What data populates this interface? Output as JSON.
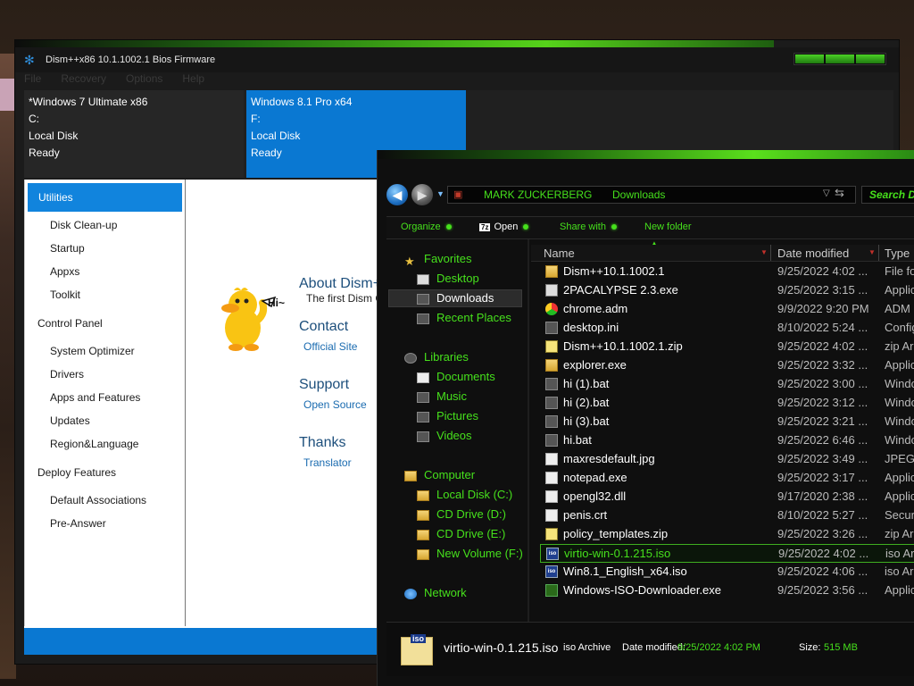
{
  "dism": {
    "title": "Dism++x86 10.1.1002.1 Bios Firmware",
    "menu": [
      "File",
      "Recovery",
      "Options",
      "Help"
    ],
    "sessions": [
      {
        "name": "*Windows 7 Ultimate x86",
        "drive": "C:",
        "disk": "Local Disk",
        "status": "Ready"
      },
      {
        "name": "Windows 8.1 Pro x64",
        "drive": "F:",
        "disk": "Local Disk",
        "status": "Ready"
      }
    ],
    "sidebar": {
      "selected": "Utilities",
      "utilities": [
        "Disk Clean-up",
        "Startup",
        "Appxs",
        "Toolkit"
      ],
      "control_panel": "Control Panel",
      "control_items": [
        "System Optimizer",
        "Drivers",
        "Apps and Features",
        "Updates",
        "Region&Language"
      ],
      "deploy": "Deploy Features",
      "deploy_items": [
        "Default Associations",
        "Pre-Answer"
      ]
    },
    "about": {
      "duck_text": "Hi~",
      "title": "About Dism++",
      "subtitle": "The first Dism GUI",
      "contact": "Contact",
      "contact_link": "Official Site",
      "support": "Support",
      "support_link": "Open Source",
      "thanks": "Thanks",
      "thanks_link": "Translator"
    }
  },
  "explorer": {
    "breadcrumb": [
      "MARK ZUCKERBERG",
      "Downloads"
    ],
    "search_placeholder": "Search D",
    "commands": {
      "organize": "Organize",
      "open": "Open",
      "share": "Share with",
      "new_folder": "New folder"
    },
    "nav": {
      "favorites": "Favorites",
      "desktop": "Desktop",
      "downloads": "Downloads",
      "recent": "Recent Places",
      "libraries": "Libraries",
      "documents": "Documents",
      "music": "Music",
      "pictures": "Pictures",
      "videos": "Videos",
      "computer": "Computer",
      "drive_c": "Local Disk (C:)",
      "drive_d": "CD Drive (D:)",
      "drive_e": "CD Drive (E:)",
      "drive_f": "New Volume (F:)",
      "network": "Network"
    },
    "columns": {
      "name": "Name",
      "date": "Date modified",
      "type": "Type"
    },
    "files": [
      {
        "name": "Dism++10.1.1002.1",
        "date": "9/25/2022 4:02 ...",
        "type": "File fo",
        "icon": "folder"
      },
      {
        "name": "2PACALYPSE 2.3.exe",
        "date": "9/25/2022 3:15 ...",
        "type": "Applic",
        "icon": "exe"
      },
      {
        "name": "chrome.adm",
        "date": "9/9/2022 9:20 PM",
        "type": "ADM F",
        "icon": "chrome"
      },
      {
        "name": "desktop.ini",
        "date": "8/10/2022 5:24 ...",
        "type": "Config",
        "icon": "dark"
      },
      {
        "name": "Dism++10.1.1002.1.zip",
        "date": "9/25/2022 4:02 ...",
        "type": "zip Ar",
        "icon": "zip"
      },
      {
        "name": "explorer.exe",
        "date": "9/25/2022 3:32 ...",
        "type": "Applic",
        "icon": "folder"
      },
      {
        "name": "hi (1).bat",
        "date": "9/25/2022 3:00 ...",
        "type": "Windo",
        "icon": "dark"
      },
      {
        "name": "hi (2).bat",
        "date": "9/25/2022 3:12 ...",
        "type": "Windo",
        "icon": "dark"
      },
      {
        "name": "hi (3).bat",
        "date": "9/25/2022 3:21 ...",
        "type": "Windo",
        "icon": "dark"
      },
      {
        "name": "hi.bat",
        "date": "9/25/2022 6:46 ...",
        "type": "Windo",
        "icon": "dark"
      },
      {
        "name": "maxresdefault.jpg",
        "date": "9/25/2022 3:49 ...",
        "type": "JPEG",
        "icon": "doc"
      },
      {
        "name": "notepad.exe",
        "date": "9/25/2022 3:17 ...",
        "type": "Applic",
        "icon": "doc"
      },
      {
        "name": "opengl32.dll",
        "date": "9/17/2020 2:38 ...",
        "type": "Applic",
        "icon": "doc"
      },
      {
        "name": "penis.crt",
        "date": "8/10/2022 5:27 ...",
        "type": "Secur",
        "icon": "doc"
      },
      {
        "name": "policy_templates.zip",
        "date": "9/25/2022 3:26 ...",
        "type": "zip Ar",
        "icon": "zip"
      },
      {
        "name": "virtio-win-0.1.215.iso",
        "date": "9/25/2022 4:02 ...",
        "type": "iso Ar",
        "icon": "iso",
        "selected": true
      },
      {
        "name": "Win8.1_English_x64.iso",
        "date": "9/25/2022 4:06 ...",
        "type": "iso Ar",
        "icon": "iso"
      },
      {
        "name": "Windows-ISO-Downloader.exe",
        "date": "9/25/2022 3:56 ...",
        "type": "Applic",
        "icon": "green"
      }
    ],
    "details": {
      "icon_label": "iso",
      "name": "virtio-win-0.1.215.iso",
      "type": "iso Archive",
      "date_label": "Date modified:",
      "date_value": "9/25/2022 4:02 PM",
      "size_label": "Size:",
      "size_value": "515 MB"
    }
  }
}
